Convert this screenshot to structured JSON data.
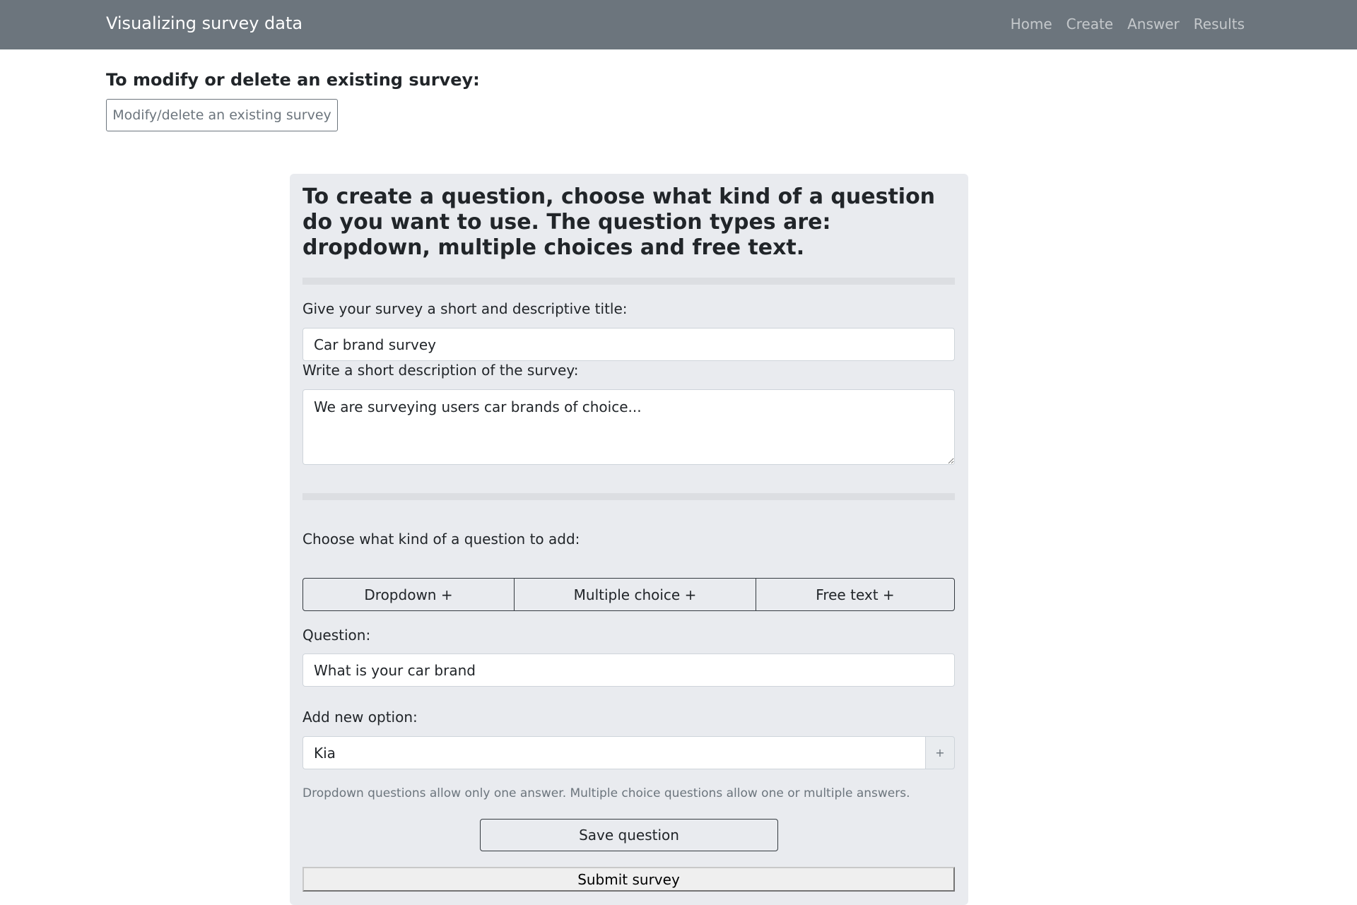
{
  "navbar": {
    "brand": "Visualizing survey data",
    "links": [
      "Home",
      "Create",
      "Answer",
      "Results"
    ]
  },
  "modify": {
    "heading": "To modify or delete an existing survey:",
    "button_label": "Modify/delete an existing survey"
  },
  "card": {
    "title": "To create a question, choose what kind of a question do you want to use. The question types are: dropdown, multiple choices and free text.",
    "survey_title_label": "Give your survey a short and descriptive title:",
    "survey_title_value": "Car brand survey",
    "description_label": "Write a short description of the survey:",
    "description_value": "We are surveying users car brands of choice...",
    "question_type_label": "Choose what kind of a question to add:",
    "question_types": [
      "Dropdown +",
      "Multiple choice +",
      "Free text +"
    ],
    "question_label": "Question:",
    "question_value": "What is your car brand",
    "option_label": "Add new option:",
    "option_value": "Kia",
    "option_add_label": "+",
    "help_text": "Dropdown questions allow only one answer. Multiple choice questions allow one or multiple answers.",
    "save_label": "Save question",
    "submit_label": "Submit survey"
  },
  "colors": {
    "navbar": "#6c757d",
    "card_background": "#e9ebef"
  }
}
